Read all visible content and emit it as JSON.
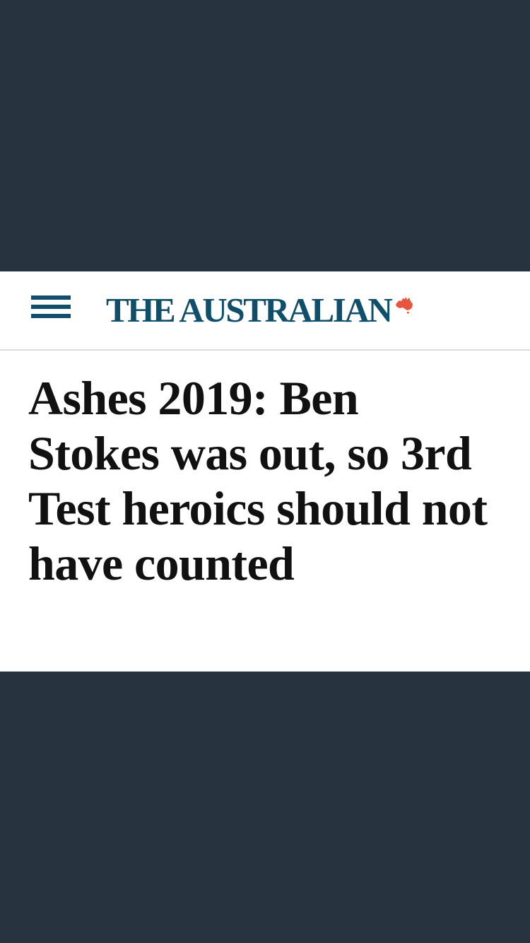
{
  "masthead": {
    "menu_icon": "hamburger-menu-icon",
    "logo_text": "THE AUSTRALIAN",
    "logo_icon": "australia-map-icon",
    "colors": {
      "brand": "#0f4f6c",
      "accent": "#e8553e"
    }
  },
  "article": {
    "headline": "Ashes 2019: Ben Stokes was out, so 3rd Test heroics should not have counted"
  },
  "background_color": "#263440"
}
